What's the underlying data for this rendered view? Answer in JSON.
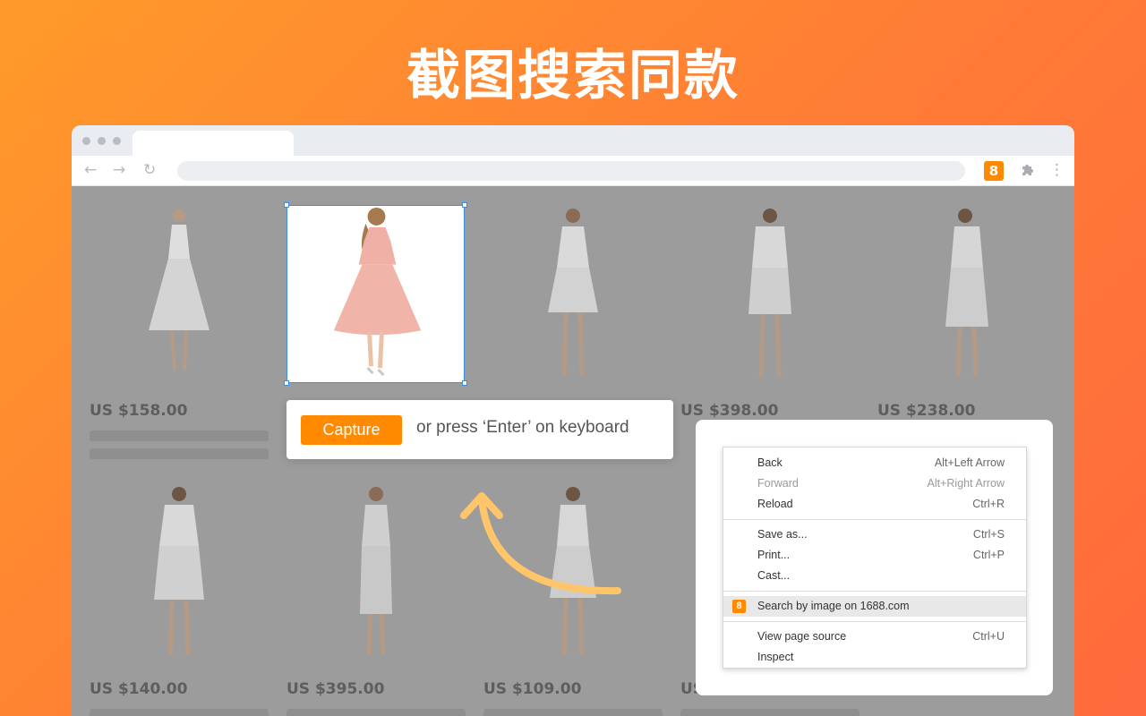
{
  "headline": "截图搜索同款",
  "colors": {
    "accent": "#ff8a00",
    "selection": "#3a8ee6",
    "backdrop_gradient": [
      "#ff9a2a",
      "#ff6a3c"
    ]
  },
  "browser": {
    "extension_badge": "8",
    "nav_icons": [
      "back-arrow-icon",
      "forward-arrow-icon",
      "reload-icon"
    ]
  },
  "products_row1": [
    {
      "price": "US $158.00"
    },
    {
      "price": ""
    },
    {
      "price": ""
    },
    {
      "price": "US $398.00"
    },
    {
      "price": "US $238.00"
    }
  ],
  "products_row2": [
    {
      "price": "US $140.00"
    },
    {
      "price": "US $395.00"
    },
    {
      "price": "US $109.00"
    },
    {
      "price": "US"
    }
  ],
  "capture": {
    "button_label": "Capture",
    "hint": "or press ‘Enter’ on keyboard"
  },
  "context_menu": {
    "group1": [
      {
        "label": "Back",
        "shortcut": "Alt+Left Arrow",
        "disabled": false
      },
      {
        "label": "Forward",
        "shortcut": "Alt+Right Arrow",
        "disabled": true
      },
      {
        "label": "Reload",
        "shortcut": "Ctrl+R",
        "disabled": false
      }
    ],
    "group2": [
      {
        "label": "Save as...",
        "shortcut": "Ctrl+S"
      },
      {
        "label": "Print...",
        "shortcut": "Ctrl+P"
      },
      {
        "label": "Cast...",
        "shortcut": ""
      }
    ],
    "highlight": {
      "label": "Search by image on 1688.com",
      "icon": "8"
    },
    "group3": [
      {
        "label": "View page source",
        "shortcut": "Ctrl+U"
      },
      {
        "label": "Inspect",
        "shortcut": ""
      }
    ]
  }
}
